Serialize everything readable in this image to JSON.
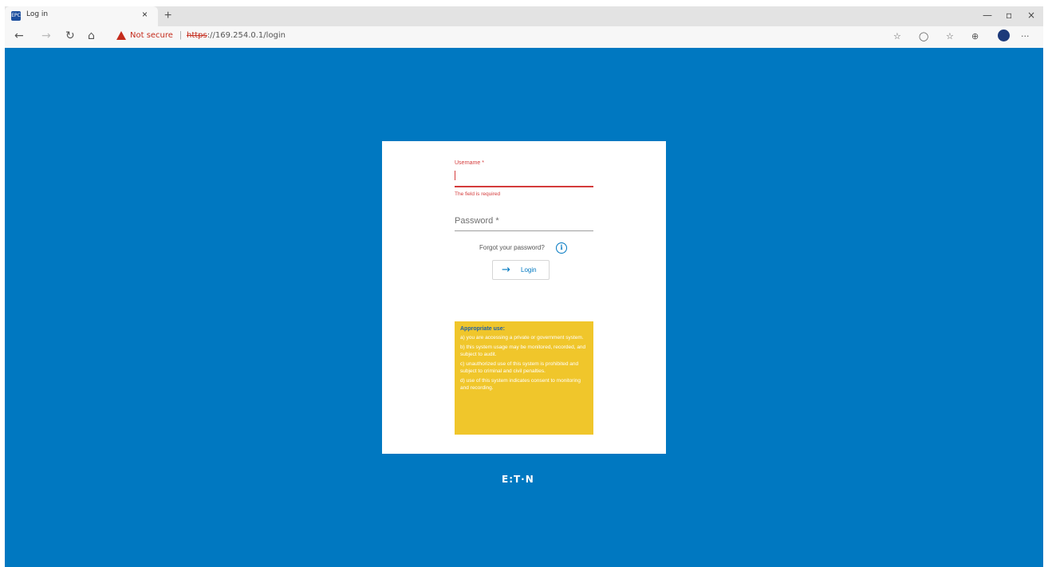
{
  "browser": {
    "tab_title": "Log in",
    "tab_favicon_text": "EPC",
    "tab_close": "×",
    "new_tab": "+",
    "window_minimize": "—",
    "window_maximize": "▫",
    "window_close": "×",
    "security_warning": "Not secure",
    "url_scheme": "https",
    "url_rest": "://169.254.0.1/login",
    "back": "←",
    "forward": "→",
    "refresh": "↻",
    "home": "⌂",
    "favorites_add": "☆",
    "reading": "◯",
    "favorites": "☆",
    "collections": "⊕",
    "more": "···"
  },
  "login": {
    "username_label": "Username *",
    "username_value": "",
    "username_error": "The field is required",
    "password_placeholder": "Password *",
    "forgot_password": "Forgot your password?",
    "info_icon": "i",
    "login_button": "Login",
    "login_arrow": "→"
  },
  "notice": {
    "title": "Appropriate use:",
    "items": [
      "a) you are accessing a private or government system.",
      "b) this system usage may be monitored, recorded, and subject to audit.",
      "c) unauthorized use of this system is prohibited and subject to criminal and civil penalties.",
      "d) use of this system indicates consent to monitoring and recording."
    ]
  },
  "brand": {
    "logo_text": "E:T·N"
  },
  "colors": {
    "page_background": "#0078c1",
    "error": "#d43b3b",
    "notice_background": "#f0c62b"
  }
}
